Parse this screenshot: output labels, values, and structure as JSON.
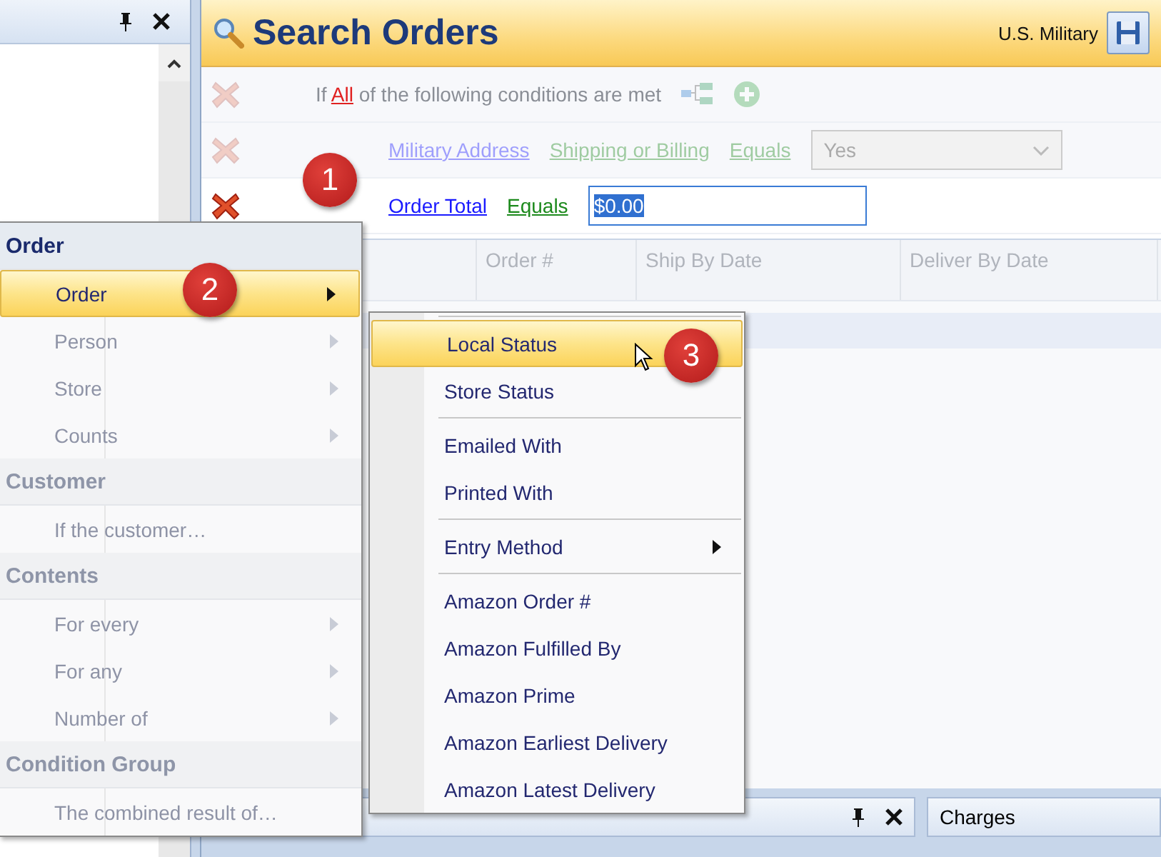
{
  "search_panel": {
    "title": "Search Orders",
    "store": "U.S. Military"
  },
  "conditions": [
    {
      "kind": "header",
      "disabled": true,
      "prefix": "If",
      "link": "All",
      "suffix": "of the following conditions are met"
    },
    {
      "kind": "choice",
      "disabled": true,
      "parts": [
        "Military Address",
        "Shipping or Billing",
        "Equals"
      ],
      "value": "Yes"
    },
    {
      "kind": "text",
      "disabled": false,
      "parts": [
        "Order Total",
        "Equals"
      ],
      "value": "$0.00"
    }
  ],
  "grid": {
    "columns": [
      "Order #",
      "Ship By Date",
      "Deliver By Date"
    ],
    "rows": [
      {
        "selected": true
      }
    ]
  },
  "charges_panel": {
    "title": "Charges"
  },
  "menu": {
    "sections": [
      {
        "header": "Order",
        "disabled": false,
        "items": [
          {
            "label": "Order",
            "selected": true,
            "disabled": false,
            "submenu": true
          },
          {
            "label": "Person",
            "selected": false,
            "disabled": true,
            "submenu": true
          },
          {
            "label": "Store",
            "selected": false,
            "disabled": true,
            "submenu": true
          },
          {
            "label": "Counts",
            "selected": false,
            "disabled": true,
            "submenu": true
          }
        ]
      },
      {
        "header": "Customer",
        "disabled": true,
        "items": [
          {
            "label": "If the customer…",
            "selected": false,
            "disabled": true,
            "submenu": false
          }
        ]
      },
      {
        "header": "Contents",
        "disabled": true,
        "items": [
          {
            "label": "For every",
            "selected": false,
            "disabled": true,
            "submenu": true
          },
          {
            "label": "For any",
            "selected": false,
            "disabled": true,
            "submenu": true
          },
          {
            "label": "Number of",
            "selected": false,
            "disabled": true,
            "submenu": true
          }
        ]
      },
      {
        "header": "Condition Group",
        "disabled": true,
        "items": [
          {
            "label": "The combined result of…",
            "selected": false,
            "disabled": true,
            "submenu": false
          }
        ]
      }
    ]
  },
  "submenu": {
    "groups": [
      [
        {
          "label": "Local Status",
          "selected": true,
          "submenu": false
        },
        {
          "label": "Store Status",
          "selected": false,
          "submenu": false
        }
      ],
      [
        {
          "label": "Emailed With",
          "selected": false,
          "submenu": false
        },
        {
          "label": "Printed With",
          "selected": false,
          "submenu": false
        }
      ],
      [
        {
          "label": "Entry Method",
          "selected": false,
          "submenu": true
        }
      ],
      [
        {
          "label": "Amazon Order #",
          "selected": false,
          "submenu": false
        },
        {
          "label": "Amazon Fulfilled By",
          "selected": false,
          "submenu": false
        },
        {
          "label": "Amazon Prime",
          "selected": false,
          "submenu": false
        },
        {
          "label": "Amazon Earliest Delivery",
          "selected": false,
          "submenu": false
        },
        {
          "label": "Amazon Latest Delivery",
          "selected": false,
          "submenu": false
        }
      ]
    ]
  },
  "callouts": [
    "1",
    "2",
    "3"
  ]
}
